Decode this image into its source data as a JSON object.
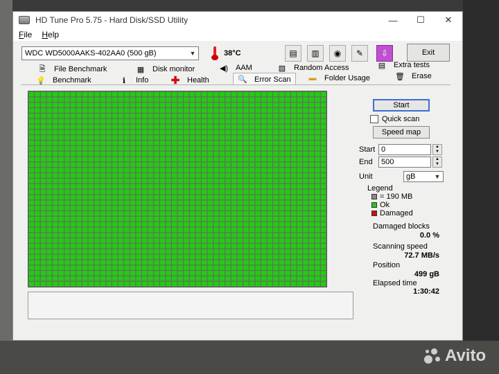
{
  "window": {
    "title": "HD Tune Pro 5.75 - Hard Disk/SSD Utility",
    "minimize": "—",
    "maximize": "☐",
    "close": "✕"
  },
  "menu": {
    "file": "File",
    "help": "Help"
  },
  "toolbar": {
    "drive": "WDC WD5000AAKS-402AA0 (500 gB)",
    "temperature": "38°C",
    "exit_label": "Exit",
    "icons": [
      "copy-info-icon",
      "copy-screenshot-icon",
      "camera-icon",
      "options-icon",
      "save-icon"
    ]
  },
  "tabs": {
    "file_benchmark": "File Benchmark",
    "disk_monitor": "Disk monitor",
    "aam": "AAM",
    "random_access": "Random Access",
    "extra_tests": "Extra tests",
    "benchmark": "Benchmark",
    "info": "Info",
    "health": "Health",
    "error_scan": "Error Scan",
    "folder_usage": "Folder Usage",
    "erase": "Erase"
  },
  "scan": {
    "start_label": "Start",
    "quick_scan_label": "Quick scan",
    "quick_scan_checked": false,
    "speed_map_label": "Speed map",
    "start_field_label": "Start",
    "start_value": "0",
    "end_field_label": "End",
    "end_value": "500",
    "unit_label": "Unit",
    "unit_value": "gB",
    "legend_title": "Legend",
    "legend_block": "= 190 MB",
    "legend_ok": "Ok",
    "legend_damaged": "Damaged",
    "damaged_blocks_label": "Damaged blocks",
    "damaged_blocks_value": "0.0 %",
    "scanning_speed_label": "Scanning speed",
    "scanning_speed_value": "72.7 MB/s",
    "position_label": "Position",
    "position_value": "499 gB",
    "elapsed_label": "Elapsed time",
    "elapsed_value": "1:30:42"
  },
  "grid": {
    "columns": 50,
    "rows": 36,
    "ok_color": "#22cc11",
    "damaged_color": "#cc1111",
    "line_color": "#6a6a6a",
    "damaged_blocks": 0
  },
  "watermark": {
    "text": "Avito"
  }
}
